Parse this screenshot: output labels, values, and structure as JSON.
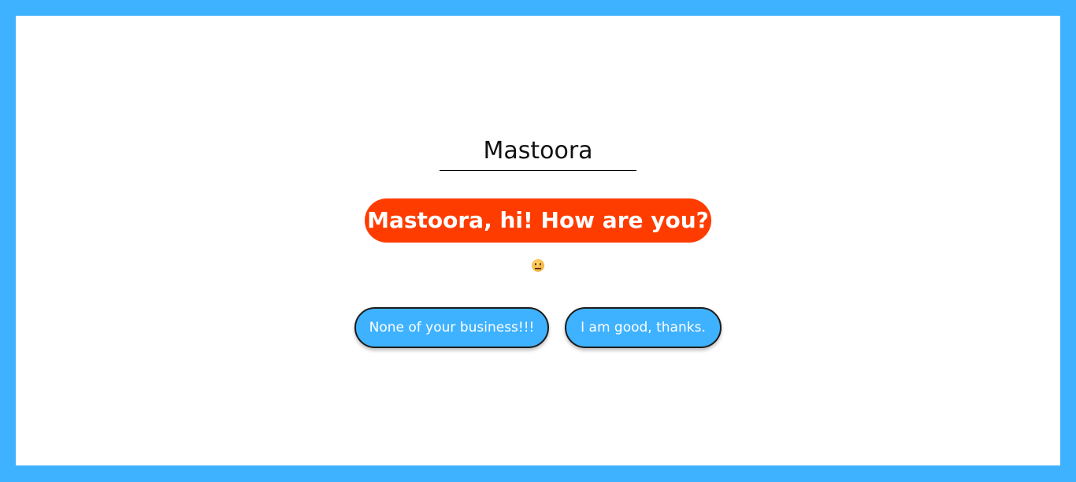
{
  "name_input": {
    "value": "Mastoora"
  },
  "greeting": {
    "text": "Mastoora, hi! How are you?"
  },
  "mood_icon": "neutral-face-emoji",
  "replies": {
    "rude_label": "None of your business!!!",
    "nice_label": "I am good, thanks."
  },
  "colors": {
    "page_border": "#3fb2ff",
    "greeting_bg": "#ff3c00",
    "button_bg": "#3fb2ff"
  }
}
